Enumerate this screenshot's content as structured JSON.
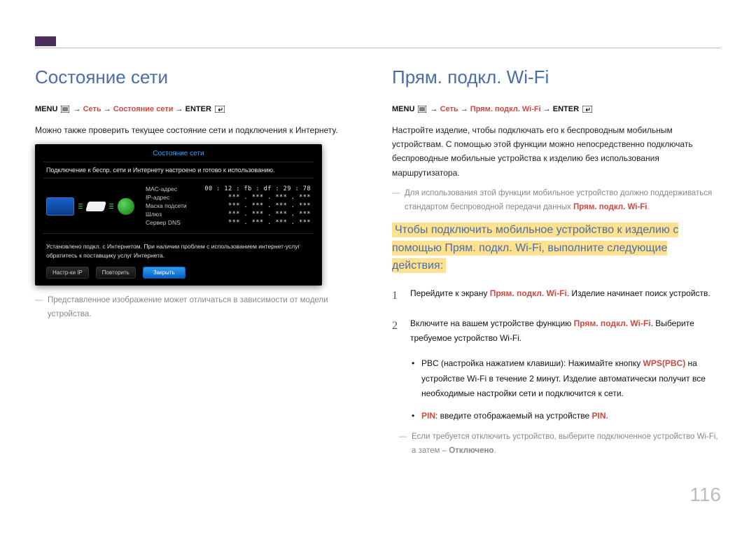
{
  "page_number": "116",
  "left": {
    "heading": "Состояние сети",
    "path_menu": "MENU",
    "path_net": "Сеть",
    "path_item": "Состояние сети",
    "path_enter": "ENTER",
    "body": "Можно также проверить текущее состояние сети и подключения к Интернету.",
    "screenshot": {
      "title": "Состояние сети",
      "top_msg": "Подключение к беспр. сети и Интернету настроено и готово к использованию.",
      "rows": [
        {
          "k": "MAC-адрес",
          "v": "00 : 12 : fb : df : 29 : 78"
        },
        {
          "k": "IP-адрес",
          "v": "*** . *** . *** . ***"
        },
        {
          "k": "Маска подсети",
          "v": "*** . *** . *** . ***"
        },
        {
          "k": "Шлюз",
          "v": "*** . *** . *** . ***"
        },
        {
          "k": "Сервер DNS",
          "v": "*** . *** . *** . ***"
        }
      ],
      "msg": "Установлено подкл. с Интернетом. При наличии проблем с использованием интернет-услуг обратитесь к поставщику услуг Интернета.",
      "btn1": "Настр-ки IP",
      "btn2": "Повторить",
      "btn3": "Закрыть"
    },
    "note": "Представленное изображение может отличаться в зависимости от модели устройства."
  },
  "right": {
    "heading": "Прям. подкл. Wi-Fi",
    "path_menu": "MENU",
    "path_net": "Сеть",
    "path_item": "Прям. подкл. Wi-Fi",
    "path_enter": "ENTER",
    "body": "Настройте изделие, чтобы подключать его к беспроводным мобильным устройствам. С помощью этой функции можно непосредственно подключать беспроводные мобильные устройства к изделию без использования маршрутизатора.",
    "note1_a": "Для использования этой функции мобильное устройство должно поддерживаться стандартом беспроводной передачи данных ",
    "note1_b": "Прям. подкл. Wi-Fi",
    "highlight": "Чтобы подключить мобильное устройство к изделию с помощью Прям. подкл. Wi-Fi, выполните следующие действия:",
    "step1_a": "Перейдите к экрану ",
    "step1_b": "Прям. подкл. Wi-Fi",
    "step1_c": ". Изделие начинает поиск устройств.",
    "step2_a": "Включите на вашем устройстве функцию ",
    "step2_b": "Прям. подкл. Wi-Fi",
    "step2_c": ". Выберите требуемое устройство Wi-Fi.",
    "bullet1_a": "PBC (настройка нажатием клавиши): Нажимайте кнопку ",
    "bullet1_b": "WPS(PBC)",
    "bullet1_c": " на устройстве Wi-Fi в течение 2 минут. Изделие автоматически получит все необходимые настройки сети и подключится к сети.",
    "bullet2_a": "PIN",
    "bullet2_b": ": введите отображаемый на устройстве ",
    "bullet2_c": "PIN",
    "bullet2_d": ".",
    "note2_a": "Если требуется отключить устройство, выберите подключенное устройство Wi-Fi, а затем – ",
    "note2_b": "Отключено",
    "note2_c": "."
  }
}
